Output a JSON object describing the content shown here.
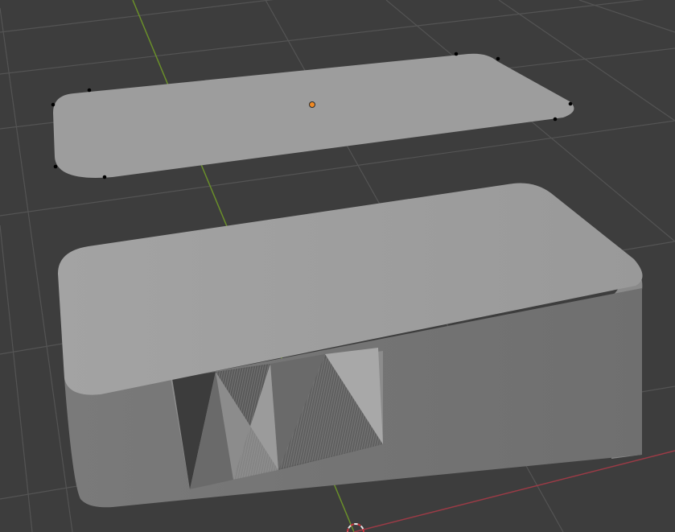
{
  "viewport": {
    "background_color": "#3d3d3d",
    "grid_line_color": "#545454",
    "y_axis_color": "#6a8f2a",
    "x_axis_color": "#9b3b46",
    "cursor_color": "#e8e8e8",
    "cursor_accent_color": "#c8323c"
  },
  "objects": {
    "plane": {
      "kind": "flat-rounded-rectangle",
      "face_color": "#9d9d9d",
      "vertex_color": "#000000",
      "origin_color": "#f08a24",
      "selected": false
    },
    "box": {
      "kind": "rounded-box-with-boolean-cut",
      "top_color": "#9e9e9e",
      "side_color": "#8a8a8a",
      "front_color": "#757575",
      "cut_dark_color": "#3c3c3c",
      "cut_mid_color": "#8c8c8c"
    }
  }
}
